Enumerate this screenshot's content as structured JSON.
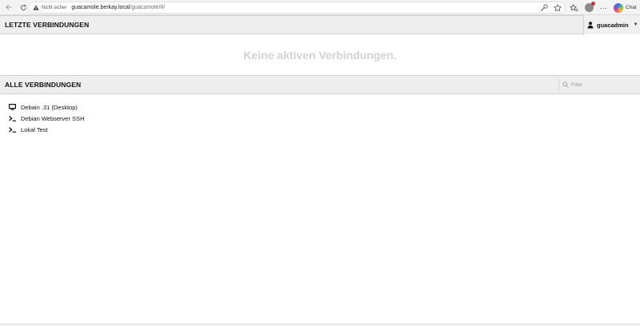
{
  "browser": {
    "not_secure_label": "Nicht sicher",
    "url_host": "guacamole.berkay.local",
    "url_path": "/guacamole/#/",
    "more_label": "···",
    "chat_label": "Chat"
  },
  "recent": {
    "title": "LETZTE VERBINDUNGEN",
    "user_name": "guacadmin",
    "empty_text": "Keine aktiven Verbindungen."
  },
  "all": {
    "title": "ALLE VERBINDUNGEN",
    "filter_placeholder": "Filter",
    "connections": [
      {
        "label": "Debain .31 (Desktop)",
        "icon": "desktop-icon"
      },
      {
        "label": "Debian Webserver SSH",
        "icon": "terminal-icon"
      },
      {
        "label": "Lokal Test",
        "icon": "terminal-icon"
      }
    ]
  },
  "colors": {
    "header_bg": "#eeeeee",
    "empty_text": "#d2d2d2"
  }
}
